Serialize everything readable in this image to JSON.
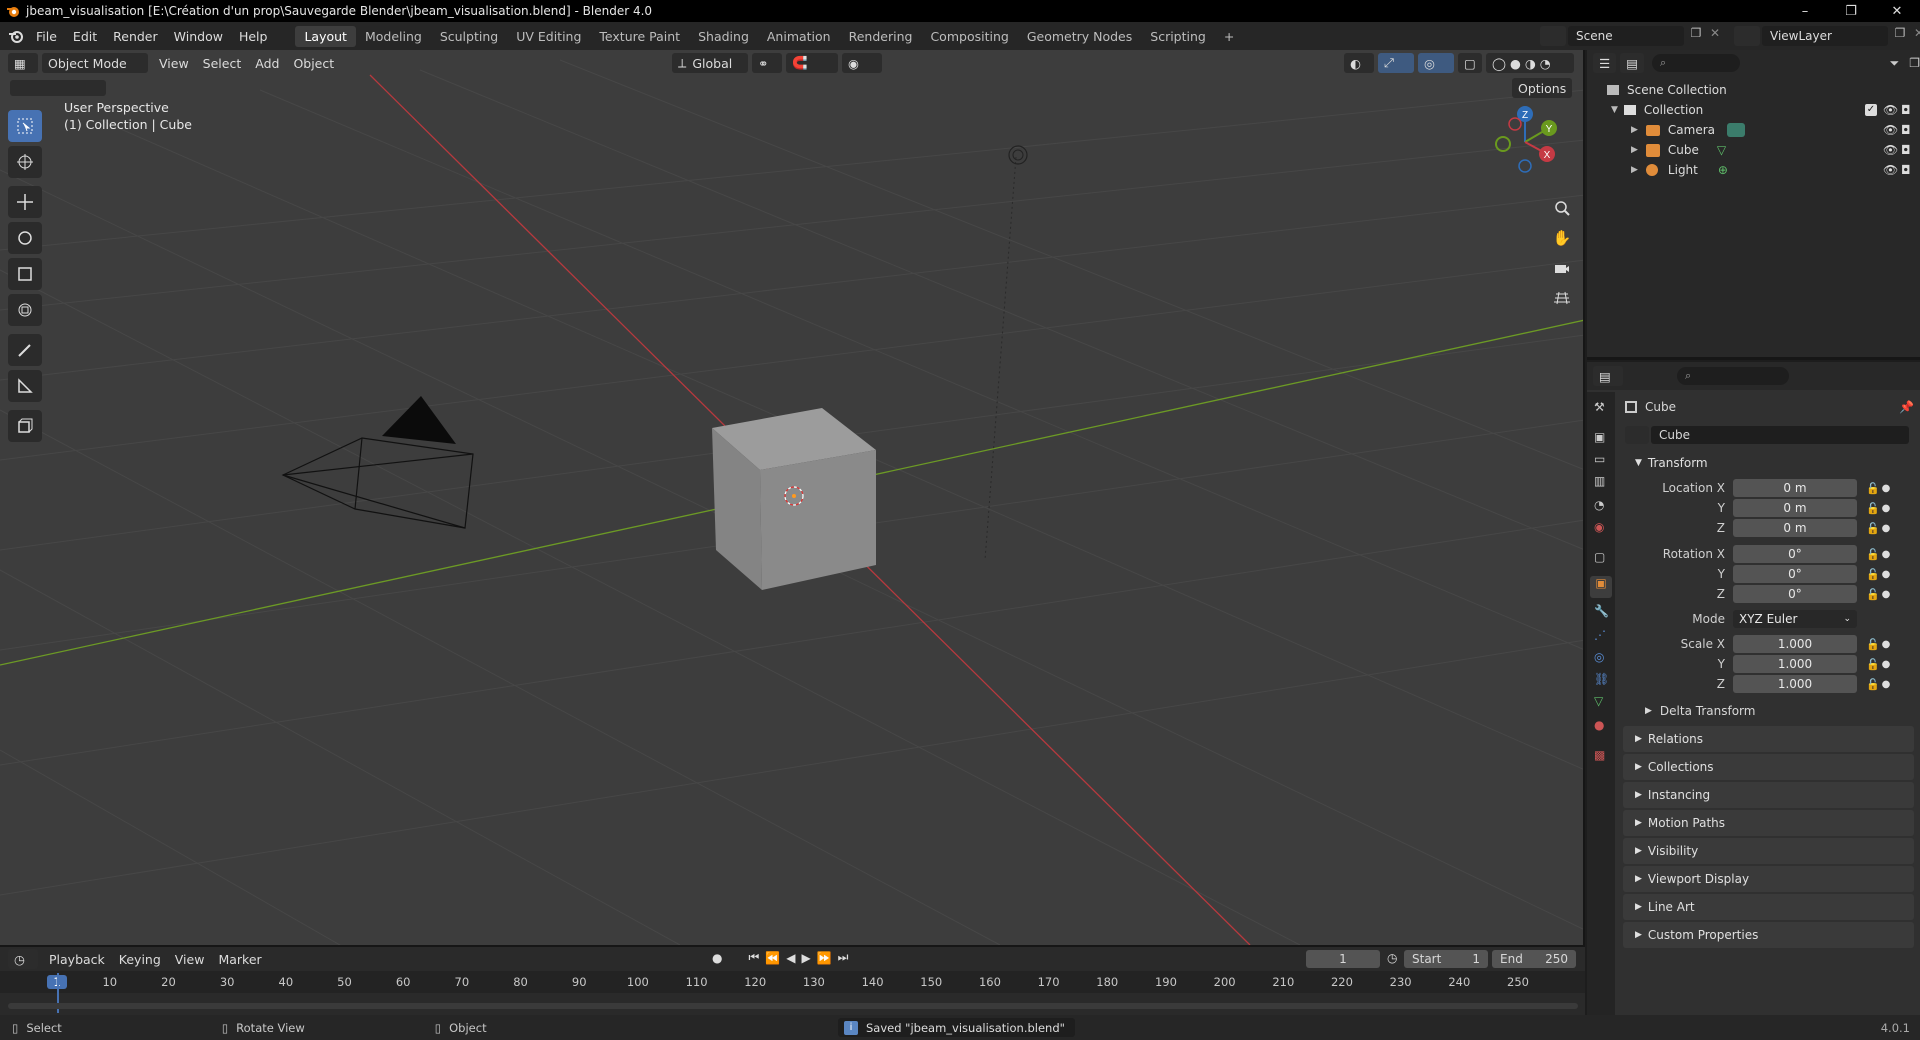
{
  "window": {
    "title": "jbeam_visualisation [E:\\Création d'un prop\\Sauvegarde Blender\\jbeam_visualisation.blend] - Blender 4.0",
    "minimize": "–",
    "maximize": "❐",
    "close": "✕"
  },
  "menu": {
    "items": [
      "File",
      "Edit",
      "Render",
      "Window",
      "Help"
    ],
    "workspaces": [
      "Layout",
      "Modeling",
      "Sculpting",
      "UV Editing",
      "Texture Paint",
      "Shading",
      "Animation",
      "Rendering",
      "Compositing",
      "Geometry Nodes",
      "Scripting"
    ],
    "add_tab": "+",
    "scene": "Scene",
    "view_layer": "ViewLayer"
  },
  "viewport": {
    "mode": "Object Mode",
    "menus": [
      "View",
      "Select",
      "Add",
      "Object"
    ],
    "orientation": "Global",
    "options_label": "Options",
    "perspective_label": "User Perspective",
    "context_label": "(1) Collection | Cube",
    "gizmo": {
      "x": "X",
      "y": "Y",
      "z": "Z"
    },
    "colors": {
      "background": "#3d3d3d",
      "x_axis": "#b7393e",
      "y_axis": "#6c9a25",
      "grid": "#4a4a4a"
    }
  },
  "outliner": {
    "root": "Scene Collection",
    "collection": "Collection",
    "objects": [
      {
        "name": "Camera",
        "icon": "camera-icon"
      },
      {
        "name": "Cube",
        "icon": "mesh-icon"
      },
      {
        "name": "Light",
        "icon": "light-icon"
      }
    ]
  },
  "properties": {
    "object_name": "Cube",
    "data_name": "Cube",
    "transform_label": "Transform",
    "location": {
      "label": "Location X",
      "x": "0 m",
      "y": "0 m",
      "z": "0 m"
    },
    "rotation": {
      "label": "Rotation X",
      "x": "0°",
      "y": "0°",
      "z": "0°"
    },
    "mode": {
      "label": "Mode",
      "value": "XYZ Euler"
    },
    "scale": {
      "label": "Scale X",
      "x": "1.000",
      "y": "1.000",
      "z": "1.000"
    },
    "axis_y": "Y",
    "axis_z": "Z",
    "delta_transform": "Delta Transform",
    "panels": [
      "Relations",
      "Collections",
      "Instancing",
      "Motion Paths",
      "Visibility",
      "Viewport Display",
      "Line Art",
      "Custom Properties"
    ]
  },
  "timeline": {
    "menus": [
      "Playback",
      "Keying",
      "View",
      "Marker"
    ],
    "current_frame": "1",
    "start_label": "Start",
    "start": "1",
    "end_label": "End",
    "end": "250",
    "ticks": [
      "1",
      "10",
      "20",
      "30",
      "40",
      "50",
      "60",
      "70",
      "80",
      "90",
      "100",
      "110",
      "120",
      "130",
      "140",
      "150",
      "160",
      "170",
      "180",
      "190",
      "200",
      "210",
      "220",
      "230",
      "240",
      "250"
    ]
  },
  "status": {
    "select": "Select",
    "rotate": "Rotate View",
    "object": "Object",
    "message": "Saved \"jbeam_visualisation.blend\"",
    "version": "4.0.1"
  }
}
